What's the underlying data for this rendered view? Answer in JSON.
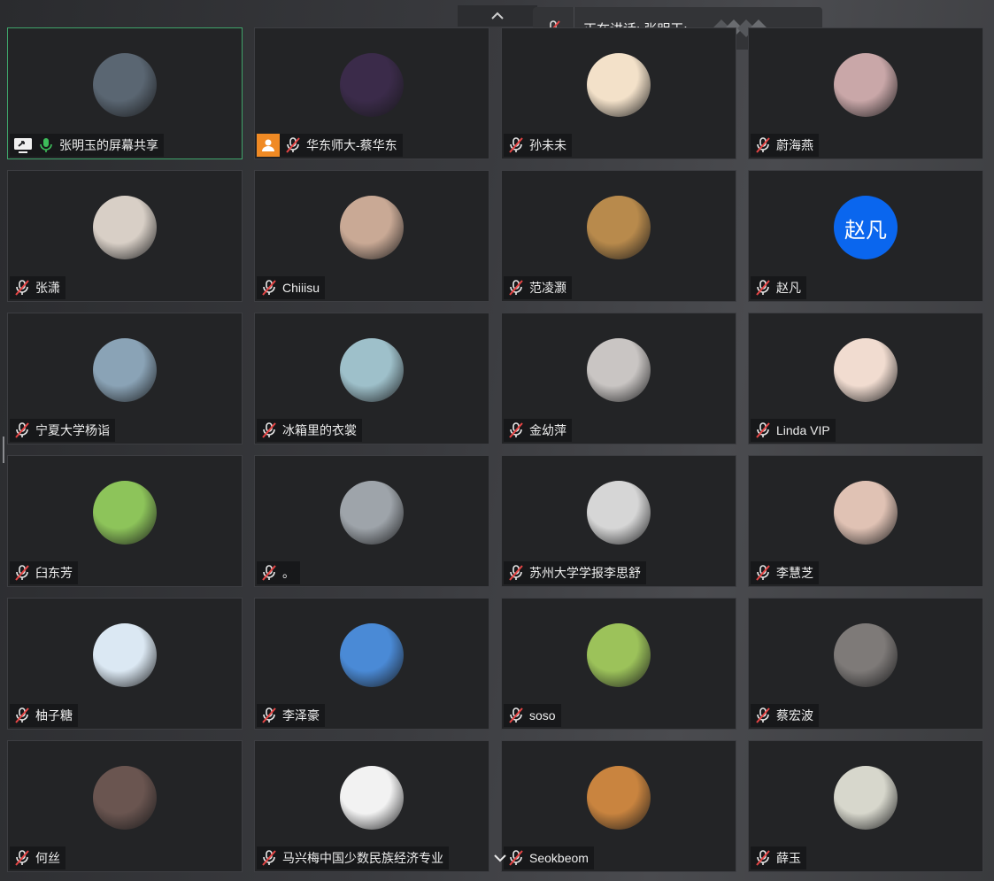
{
  "top_bar": {
    "speaking_text": "正在讲话: 张明玉;"
  },
  "colors": {
    "tile_bg": "#232426",
    "active_border": "#3fa36a",
    "mic_muted": "#e8e8e8",
    "mic_active": "#3dbd5a",
    "text_avatar_bg": "#0a66ee",
    "user_icon_bg": "#f08a24"
  },
  "participants": [
    {
      "name": "张明玉的屏幕共享",
      "type": "screen-share",
      "avatar": "photo",
      "avatar_color": "#5a6672"
    },
    {
      "name": "华东师大-蔡华东",
      "type": "muted-user-icon",
      "avatar": "photo",
      "avatar_color": "#3b2b4a"
    },
    {
      "name": "孙未未",
      "type": "muted",
      "avatar": "cartoon",
      "avatar_color": "#f3e1c9"
    },
    {
      "name": "蔚海燕",
      "type": "muted",
      "avatar": "photo",
      "avatar_color": "#c9a7a8"
    },
    {
      "name": "张潇",
      "type": "muted",
      "avatar": "photo",
      "avatar_color": "#d8cfc6"
    },
    {
      "name": "Chiiisu",
      "type": "muted",
      "avatar": "photo",
      "avatar_color": "#c9a995"
    },
    {
      "name": "范凌灏",
      "type": "muted",
      "avatar": "cartoon",
      "avatar_color": "#b88a4c"
    },
    {
      "name": "赵凡",
      "type": "muted",
      "avatar": "text",
      "avatar_text": "赵凡",
      "avatar_color": "#0a66ee"
    },
    {
      "name": "宁夏大学杨诣",
      "type": "muted",
      "avatar": "photo",
      "avatar_color": "#8aa3b6"
    },
    {
      "name": "冰箱里的衣裳",
      "type": "muted",
      "avatar": "cartoon",
      "avatar_color": "#9ec0ca"
    },
    {
      "name": "金幼萍",
      "type": "muted",
      "avatar": "photo",
      "avatar_color": "#c9c5c3"
    },
    {
      "name": "Linda VIP",
      "type": "muted",
      "avatar": "cartoon",
      "avatar_color": "#f1dcd0"
    },
    {
      "name": "臼东芳",
      "type": "muted",
      "avatar": "cartoon",
      "avatar_color": "#8dc45a"
    },
    {
      "name": "。",
      "type": "muted",
      "avatar": "photo",
      "avatar_color": "#9ea4aa"
    },
    {
      "name": "苏州大学学报李思舒",
      "type": "muted",
      "avatar": "photo",
      "avatar_color": "#d6d6d6"
    },
    {
      "name": "李慧芝",
      "type": "muted",
      "avatar": "cartoon",
      "avatar_color": "#e0c2b4"
    },
    {
      "name": "柚子糖",
      "type": "muted",
      "avatar": "cartoon",
      "avatar_color": "#dbe8f3"
    },
    {
      "name": "李泽豪",
      "type": "muted",
      "avatar": "photo",
      "avatar_color": "#4a8ad6"
    },
    {
      "name": "soso",
      "type": "muted",
      "avatar": "photo",
      "avatar_color": "#9cc25a"
    },
    {
      "name": "蔡宏波",
      "type": "muted",
      "avatar": "photo",
      "avatar_color": "#7e7a78"
    },
    {
      "name": "何丝",
      "type": "muted",
      "avatar": "photo",
      "avatar_color": "#6a5550"
    },
    {
      "name": "马兴梅中国少数民族经济专业",
      "type": "muted",
      "avatar": "cartoon",
      "avatar_color": "#f2f2f2"
    },
    {
      "name": "Seokbeom",
      "type": "muted",
      "avatar": "photo",
      "avatar_color": "#c9843f"
    },
    {
      "name": "薛玉",
      "type": "muted",
      "avatar": "photo",
      "avatar_color": "#d7d7cc"
    }
  ]
}
